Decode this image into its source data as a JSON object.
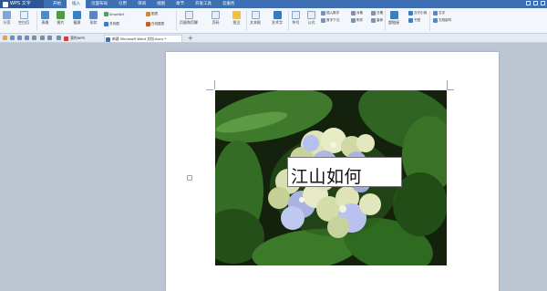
{
  "app": {
    "name": "WPS 文字"
  },
  "menu": [
    "开始",
    "插入",
    "页面布局",
    "引用",
    "审阅",
    "视图",
    "章节",
    "开发工具",
    "云服务"
  ],
  "menu_active_index": 1,
  "ribbon": {
    "large": [
      "分页",
      "空白页",
      "表格",
      "图片",
      "截屏",
      "形状",
      "页眉和页脚",
      "页码",
      "文本框",
      "艺术字",
      "公式",
      "符号",
      "超链接"
    ],
    "small": [
      "SmartArt",
      "图表",
      "在线图表",
      "插入数字",
      "对象",
      "日期",
      "首字下沉",
      "附件",
      "书签",
      "文档部件",
      "交叉引用"
    ],
    "mini": [
      "关系图",
      "窗体",
      "文字",
      "批注"
    ]
  },
  "tabs": {
    "home": "我的WPS",
    "doc": "新建 Microsoft Word 文档.docx *"
  },
  "textbox": {
    "text": "江山如何"
  },
  "colors": {
    "accent": "#3d6fb2",
    "workspace": "#bcc6d3"
  }
}
